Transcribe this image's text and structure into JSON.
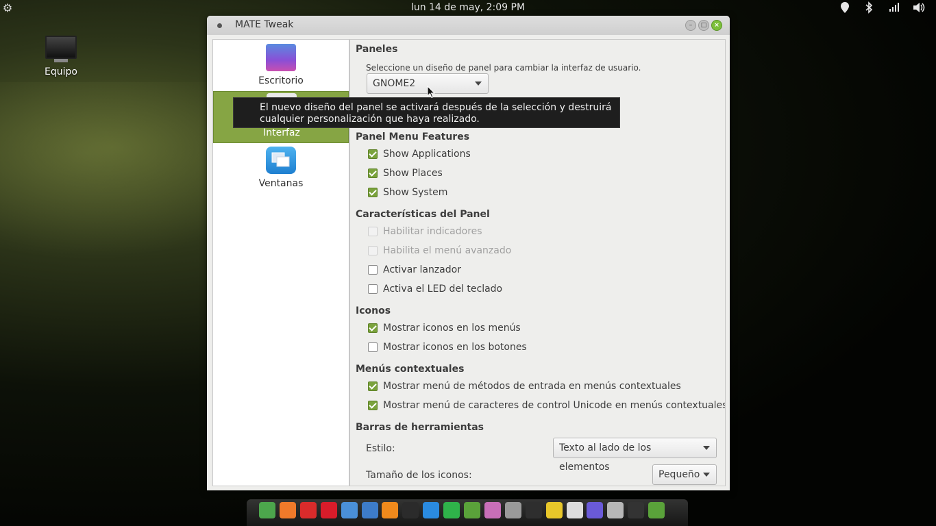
{
  "top_panel": {
    "clock": "lun 14 de may,  2:09 PM",
    "menu_icon": "gear-icon",
    "tray_icons": [
      "location-icon",
      "bluetooth-icon",
      "network-signal-icon",
      "volume-icon"
    ]
  },
  "desktop": {
    "icons": [
      {
        "label": "Equipo",
        "icon": "computer-icon"
      }
    ]
  },
  "window": {
    "title": "MATE Tweak",
    "sidebar": [
      {
        "label": "Escritorio",
        "icon": "desktop-icon",
        "selected": false
      },
      {
        "label": "Interfaz",
        "icon": "interface-icon",
        "selected": true
      },
      {
        "label": "Ventanas",
        "icon": "windows-icon",
        "selected": false
      }
    ],
    "panels": {
      "header": "Paneles",
      "hint": "Seleccione un diseño de panel para cambiar la interfaz de usuario.",
      "layout_value": "GNOME2"
    },
    "tooltip": {
      "line1": "El nuevo diseño del panel se activará después de la selección y destruirá",
      "line2": "cualquier personalización que haya realizado."
    },
    "panel_menu": {
      "header": "Panel Menu Features",
      "items": [
        {
          "label": "Show Applications",
          "checked": true,
          "enabled": true
        },
        {
          "label": "Show Places",
          "checked": true,
          "enabled": true
        },
        {
          "label": "Show System",
          "checked": true,
          "enabled": true
        }
      ]
    },
    "panel_features": {
      "header": "Características del Panel",
      "items": [
        {
          "label": "Habilitar indicadores",
          "checked": false,
          "enabled": false
        },
        {
          "label": "Habilita el menú avanzado",
          "checked": false,
          "enabled": false
        },
        {
          "label": "Activar lanzador",
          "checked": false,
          "enabled": true
        },
        {
          "label": "Activa el LED del teclado",
          "checked": false,
          "enabled": true
        }
      ]
    },
    "icons": {
      "header": "Iconos",
      "items": [
        {
          "label": "Mostrar iconos en los menús",
          "checked": true,
          "enabled": true
        },
        {
          "label": "Mostrar iconos en los botones",
          "checked": false,
          "enabled": true
        }
      ]
    },
    "context_menus": {
      "header": "Menús contextuales",
      "items": [
        {
          "label": "Mostrar menú de métodos de entrada en menús contextuales",
          "checked": true,
          "enabled": true
        },
        {
          "label": "Mostrar menú de caracteres de control Unicode  en menús contextuales",
          "checked": true,
          "enabled": true
        }
      ]
    },
    "toolbars": {
      "header": "Barras de herramientas",
      "style_label": "Estilo:",
      "style_value": "Texto al lado de los elementos",
      "icon_size_label": "Tamaño de los iconos:",
      "icon_size_value": "Pequeño"
    }
  },
  "dock": {
    "apps": [
      {
        "icon": "anchor-icon",
        "color": "#4ca64c"
      },
      {
        "icon": "firefox-icon",
        "color": "#f07a2a"
      },
      {
        "icon": "vivaldi-icon",
        "color": "#d92b2b"
      },
      {
        "icon": "opera-icon",
        "color": "#d91c2a"
      },
      {
        "icon": "chromium-icon",
        "color": "#4a90d9"
      },
      {
        "icon": "writer-icon",
        "color": "#3d7cc9"
      },
      {
        "icon": "media-player-icon",
        "color": "#f08a1c"
      },
      {
        "icon": "terminal-icon",
        "color": "#2b2b2b"
      },
      {
        "icon": "download-icon",
        "color": "#2a8be0"
      },
      {
        "icon": "sync-icon",
        "color": "#2fb34a"
      },
      {
        "icon": "archive-icon",
        "color": "#5aa23a"
      },
      {
        "icon": "settings-panel-icon",
        "color": "#c86fb8"
      },
      {
        "icon": "audio-mute-icon",
        "color": "#9a9a9a"
      },
      {
        "icon": "obs-icon",
        "color": "#2e2e2e"
      },
      {
        "icon": "notes-icon",
        "color": "#e8c72a"
      },
      {
        "icon": "screenshot-icon",
        "color": "#dddddd"
      },
      {
        "icon": "display-icon",
        "color": "#6a5ad8"
      },
      {
        "icon": "trash-icon",
        "color": "#b7b7b7"
      },
      {
        "icon": "monitor-icon",
        "color": "#333333"
      },
      {
        "icon": "home-folder-icon",
        "color": "#5aa23a"
      }
    ]
  }
}
